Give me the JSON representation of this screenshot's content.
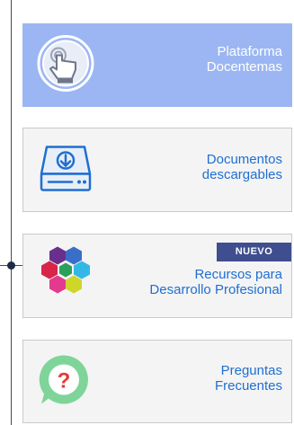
{
  "cards": [
    {
      "label_line1": "Plataforma",
      "label_line2": "Docentemas",
      "icon": "touch-screen-icon"
    },
    {
      "label_line1": "Documentos",
      "label_line2": "descargables",
      "icon": "download-drive-icon"
    },
    {
      "label_line1": "Recursos para",
      "label_line2": "Desarrollo Profesional",
      "icon": "hexagon-cluster-icon",
      "badge": "NUEVO"
    },
    {
      "label_line1": "Preguntas",
      "label_line2": "Frecuentes",
      "icon": "question-bubble-icon"
    }
  ],
  "colors": {
    "link_blue": "#1f6fd1",
    "card1_bg": "#9bb6f2",
    "badge_bg": "#3f4e8f"
  }
}
